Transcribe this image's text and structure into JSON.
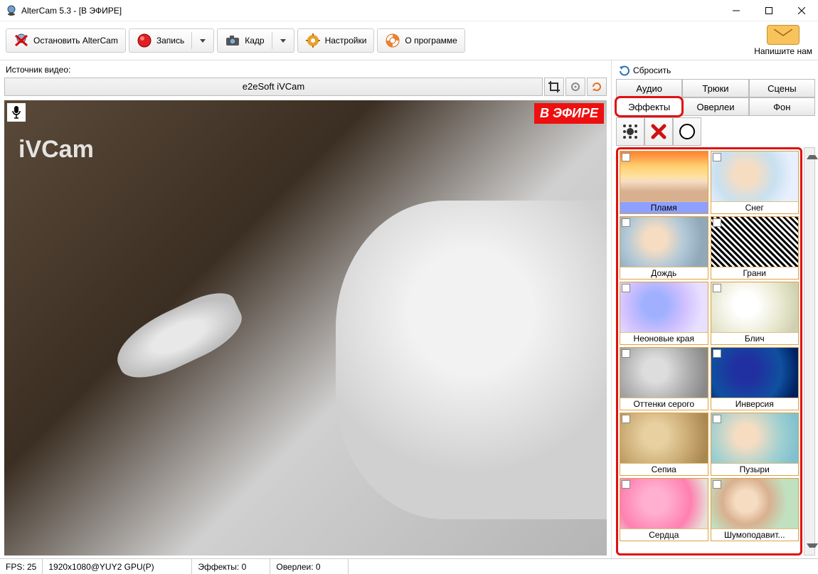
{
  "window": {
    "title": "AlterCam 5.3 - [В ЭФИРЕ]"
  },
  "toolbar": {
    "stop": "Остановить AlterCam",
    "record": "Запись",
    "frame": "Кадр",
    "settings": "Настройки",
    "about": "О программе",
    "mail": "Напишите нам"
  },
  "source": {
    "label": "Источник видео:",
    "value": "e2eSoft iVCam"
  },
  "preview": {
    "watermark": "iVCam",
    "live_badge": "В ЭФИРЕ"
  },
  "side": {
    "reset": "Сбросить",
    "tabs": {
      "audio": "Аудио",
      "tricks": "Трюки",
      "scenes": "Сцены",
      "effects": "Эффекты",
      "overlays": "Оверлеи",
      "background": "Фон"
    },
    "effects": [
      "Пламя",
      "Снег",
      "Дождь",
      "Грани",
      "Неоновые края",
      "Блич",
      "Оттенки серого",
      "Инверсия",
      "Сепиа",
      "Пузыри",
      "Сердца",
      "Шумоподавит..."
    ]
  },
  "status": {
    "fps": "FPS: 25",
    "resolution": "1920x1080@YUY2 GPU(P)",
    "effects": "Эффекты: 0",
    "overlays": "Оверлеи: 0"
  }
}
